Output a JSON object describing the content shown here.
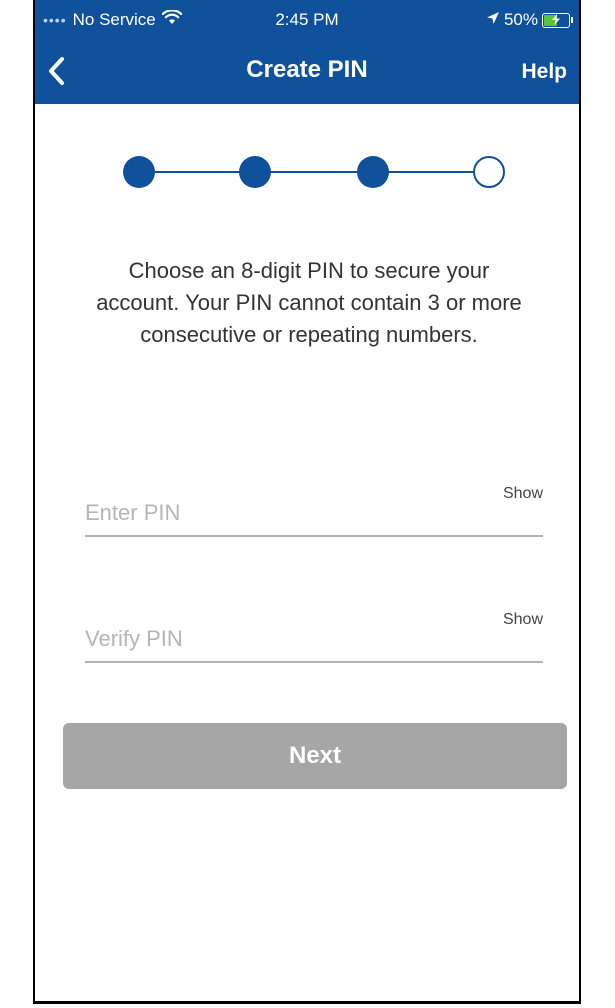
{
  "status_bar": {
    "carrier": "No Service",
    "time": "2:45 PM",
    "battery": "50%",
    "battery_level": 0.5,
    "icons": [
      "signal-dots-icon",
      "wifi-icon",
      "location-arrow-icon",
      "battery-charging-icon"
    ]
  },
  "nav": {
    "title": "Create PIN",
    "help_label": "Help",
    "back_icon": "chevron-left-icon"
  },
  "progress": {
    "total_steps": 4,
    "completed_steps": 3
  },
  "instructions": "Choose an 8-digit PIN to secure your account. Your PIN cannot contain 3 or more consecutive or repeating numbers.",
  "fields": {
    "enter_pin": {
      "placeholder": "Enter PIN",
      "value": "",
      "show_label": "Show"
    },
    "verify_pin": {
      "placeholder": "Verify PIN",
      "value": "",
      "show_label": "Show"
    }
  },
  "next_button": {
    "label": "Next",
    "enabled": false
  },
  "colors": {
    "brand": "#0f519b",
    "button_disabled": "#a6a6a6",
    "field_underline": "#b3b3b3",
    "placeholder": "#b5b5b5"
  }
}
